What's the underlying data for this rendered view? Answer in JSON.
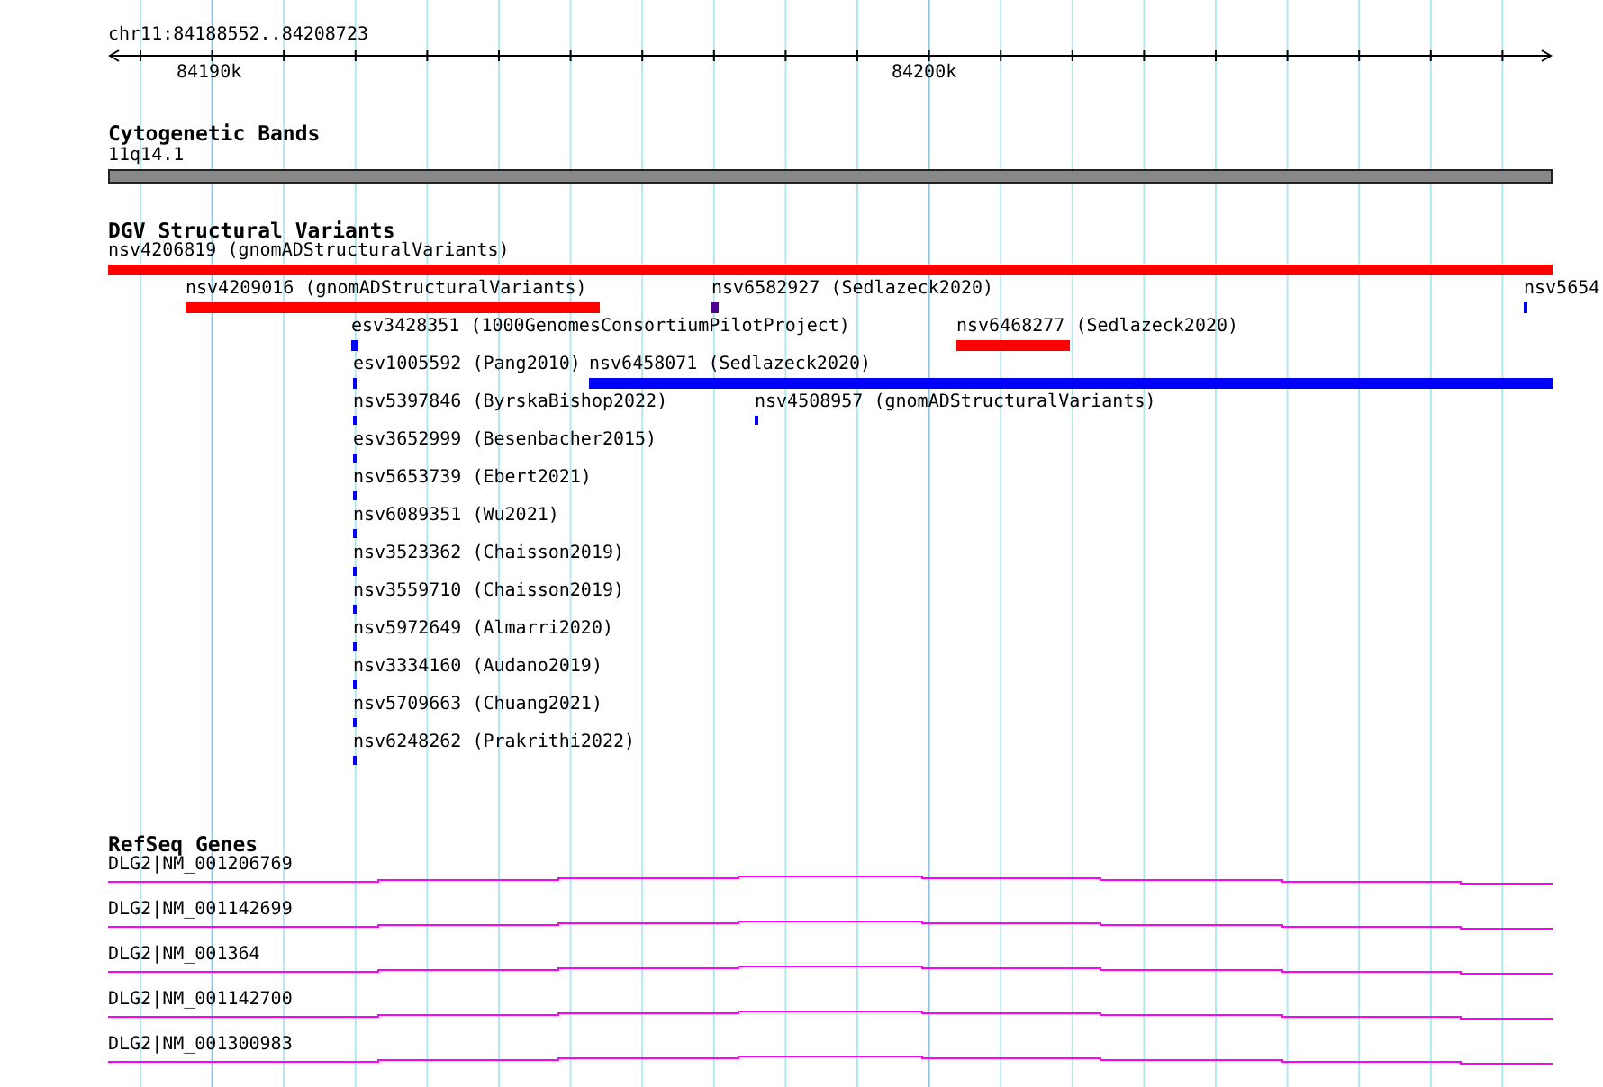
{
  "ruler": {
    "region": "chr11:84188552..84208723",
    "ticks": [
      "84190k",
      "84200k"
    ]
  },
  "tracks": [
    {
      "kind": "cytoband",
      "title": "Cytogenetic Bands",
      "bands": [
        {
          "label": "11q14.1"
        }
      ]
    },
    {
      "kind": "features",
      "title": "DGV Structural Variants",
      "features": [
        {
          "label": "nsv4206819 (gnomADStructuralVariants)",
          "color": "#ff0000"
        },
        {
          "label": "nsv4209016 (gnomADStructuralVariants)",
          "color": "#ff0000"
        },
        {
          "label": "nsv6582927 (Sedlazeck2020)",
          "color": "#500090"
        },
        {
          "label": "nsv5654",
          "color": "#0000ff"
        },
        {
          "label": "esv3428351 (1000GenomesConsortiumPilotProject)",
          "color": "#0000ff"
        },
        {
          "label": "nsv6468277 (Sedlazeck2020)",
          "color": "#ff0000"
        },
        {
          "label": "esv1005592 (Pang2010)",
          "color": "#0000ff"
        },
        {
          "label": "nsv6458071 (Sedlazeck2020)",
          "color": "#0000ff"
        },
        {
          "label": "nsv5397846 (ByrskaBishop2022)",
          "color": "#0000ff"
        },
        {
          "label": "nsv4508957 (gnomADStructuralVariants)",
          "color": "#0000ff"
        },
        {
          "label": "esv3652999 (Besenbacher2015)",
          "color": "#0000ff"
        },
        {
          "label": "nsv5653739 (Ebert2021)",
          "color": "#0000ff"
        },
        {
          "label": "nsv6089351 (Wu2021)",
          "color": "#0000ff"
        },
        {
          "label": "nsv3523362 (Chaisson2019)",
          "color": "#0000ff"
        },
        {
          "label": "nsv3559710 (Chaisson2019)",
          "color": "#0000ff"
        },
        {
          "label": "nsv5972649 (Almarri2020)",
          "color": "#0000ff"
        },
        {
          "label": "nsv3334160 (Audano2019)",
          "color": "#0000ff"
        },
        {
          "label": "nsv5709663 (Chuang2021)",
          "color": "#0000ff"
        },
        {
          "label": "nsv6248262 (Prakrithi2022)",
          "color": "#0000ff"
        }
      ]
    },
    {
      "kind": "genes",
      "title": "RefSeq Genes",
      "genes": [
        {
          "label": "DLG2|NM_001206769"
        },
        {
          "label": "DLG2|NM_001142699"
        },
        {
          "label": "DLG2|NM_001364"
        },
        {
          "label": "DLG2|NM_001142700"
        },
        {
          "label": "DLG2|NM_001300983"
        }
      ]
    }
  ]
}
